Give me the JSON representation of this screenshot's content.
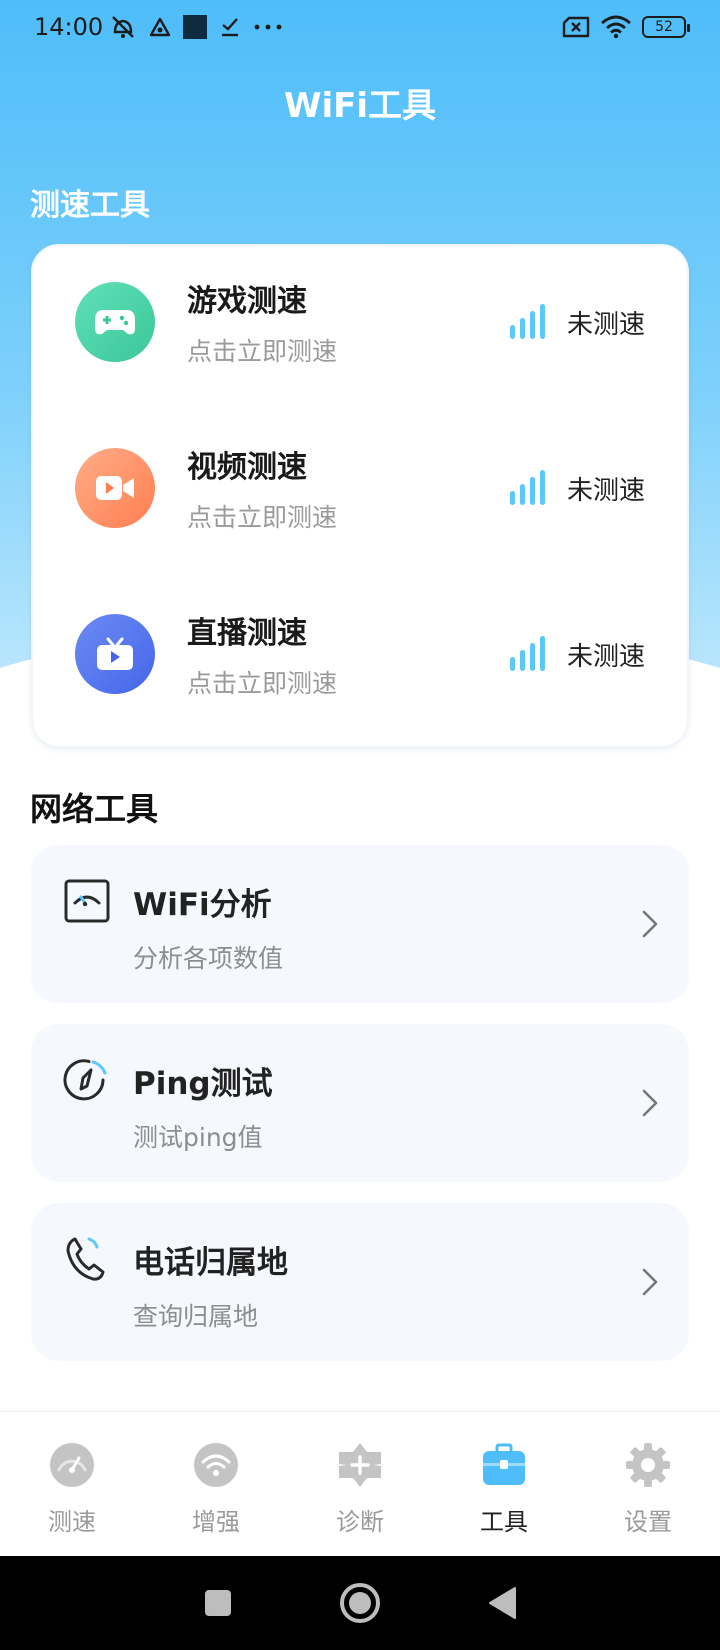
{
  "status_bar": {
    "time": "14:00",
    "battery": "52"
  },
  "header": {
    "title": "WiFi工具"
  },
  "speed_section": {
    "title": "测速工具",
    "items": [
      {
        "name": "游戏测速",
        "subtitle": "点击立即测速",
        "status": "未测速",
        "icon": "gamepad-icon"
      },
      {
        "name": "视频测速",
        "subtitle": "点击立即测速",
        "status": "未测速",
        "icon": "video-camera-icon"
      },
      {
        "name": "直播测速",
        "subtitle": "点击立即测速",
        "status": "未测速",
        "icon": "tv-icon"
      }
    ]
  },
  "network_section": {
    "title": "网络工具",
    "items": [
      {
        "name": "WiFi分析",
        "subtitle": "分析各项数值",
        "icon": "wifi-analysis-icon"
      },
      {
        "name": "Ping测试",
        "subtitle": "测试ping值",
        "icon": "ping-icon"
      },
      {
        "name": "电话归属地",
        "subtitle": "查询归属地",
        "icon": "phone-icon"
      }
    ]
  },
  "bottom_nav": {
    "items": [
      {
        "label": "测速",
        "icon": "speedometer-icon",
        "active": false
      },
      {
        "label": "增强",
        "icon": "wifi-boost-icon",
        "active": false
      },
      {
        "label": "诊断",
        "icon": "diagnose-icon",
        "active": false
      },
      {
        "label": "工具",
        "icon": "toolbox-icon",
        "active": true
      },
      {
        "label": "设置",
        "icon": "settings-gear-icon",
        "active": false
      }
    ]
  },
  "colors": {
    "accent": "#4ebdf9",
    "signal": "#5ac8fa",
    "game": "#3cc79b",
    "video": "#ff7d4f",
    "live": "#4566e8"
  }
}
